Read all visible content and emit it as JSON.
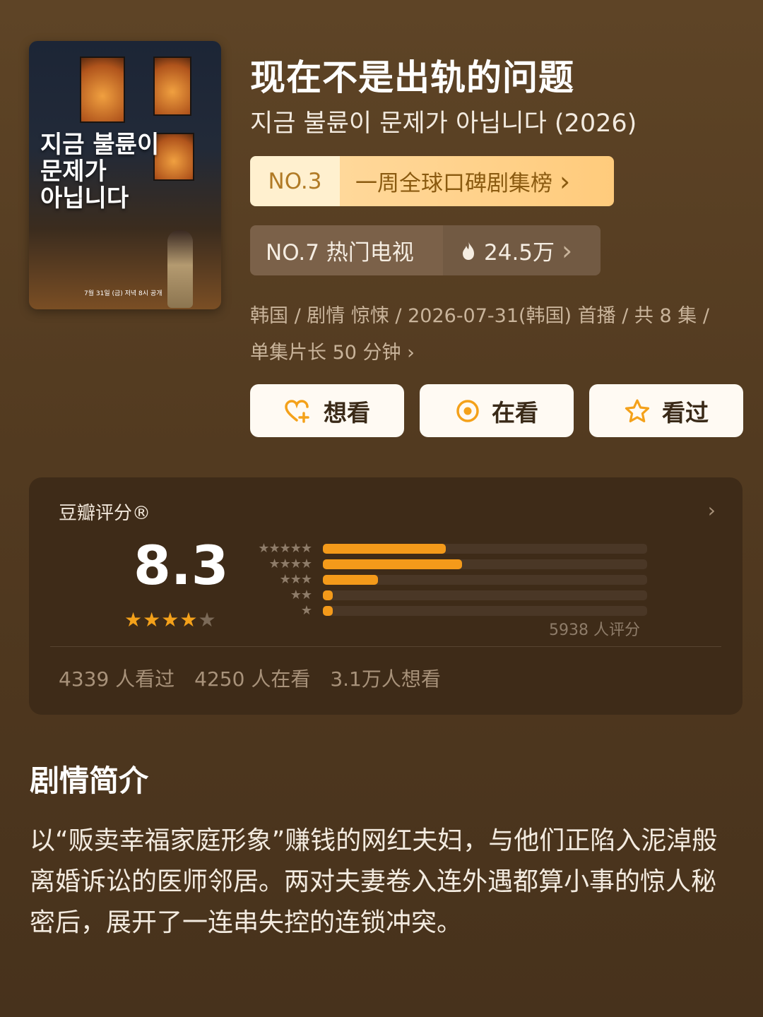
{
  "poster": {
    "title_korean": "지금 불륜이\n문제가\n아닙니다",
    "date_line": "7월 31일 (금) 저녁 8시 공개"
  },
  "show": {
    "title": "现在不是出轨的问题",
    "original_title": "지금 불륜이 문제가 아닙니다 (2026)"
  },
  "rank_primary": {
    "number": "NO.3",
    "label": "一周全球口碑剧集榜",
    "chevron": "›"
  },
  "rank_secondary": {
    "number": "NO.7 热门电视",
    "heat": "24.5万",
    "heat_icon": "flame-icon",
    "chevron": "›"
  },
  "meta": {
    "line1": "韩国 / 剧情 惊悚 / 2026-07-31(韩国) 首播 / 共 8 集 /",
    "line2": "单集片长 50 分钟 ›"
  },
  "actions": [
    {
      "label": "想看",
      "icon": "heart-plus-icon"
    },
    {
      "label": "在看",
      "icon": "target-icon"
    },
    {
      "label": "看过",
      "icon": "star-outline-icon"
    }
  ],
  "rating": {
    "header": "豆瓣评分®",
    "score": "8.3",
    "stars_filled": 4,
    "stars_total": 5,
    "distribution": [
      {
        "stars": "★★★★★",
        "fraction": 0.38
      },
      {
        "stars": "★★★★",
        "fraction": 0.43
      },
      {
        "stars": "★★★",
        "fraction": 0.17
      },
      {
        "stars": "★★",
        "fraction": 0.03
      },
      {
        "stars": "★",
        "fraction": 0.03
      }
    ],
    "count": "5938 人评分",
    "stats": [
      "4339 人看过",
      "4250 人在看",
      "3.1万人想看"
    ]
  },
  "synopsis": {
    "title": "剧情简介",
    "text": "以“贩卖幸福家庭形象”赚钱的网红夫妇，与他们正陷入泥淖般离婚诉讼的医师邻居。两对夫妻卷入连外遇都算小事的惊人秘密后，展开了一连串失控的连锁冲突。"
  },
  "colors": {
    "accent": "#f49a1a",
    "background": "#523a20",
    "card": "#3e2b18"
  }
}
